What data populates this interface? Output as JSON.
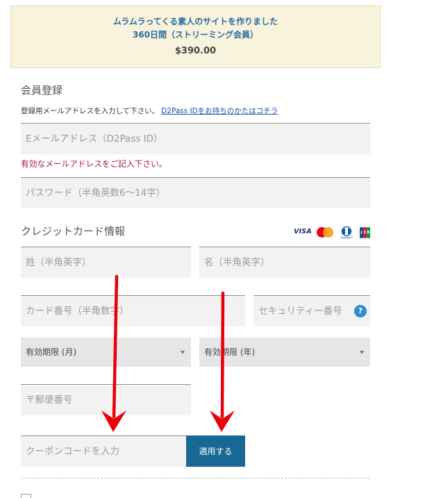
{
  "product": {
    "name": "ムラムラってくる素人のサイトを作りました",
    "plan": "360日間（ストリーミング会員）",
    "price": "$390.00"
  },
  "member": {
    "heading": "会員登録",
    "instruction": "登録用メールアドレスを入力して下さい。",
    "d2pass_link": "D2Pass IDをお持ちのかたはコチラ",
    "email": {
      "value": "",
      "placeholder": "Eメールアドレス（D2Pass ID）"
    },
    "email_error": "有効なメールアドレスをご記入下さい。",
    "password": {
      "value": "",
      "placeholder": "パスワード（半角英数6～14字）"
    }
  },
  "card": {
    "heading": "クレジットカード情報",
    "brands": [
      {
        "name": "VISA",
        "icon": "visa-logo"
      },
      {
        "name": "MasterCard",
        "icon": "mastercard-logo"
      },
      {
        "name": "Diners Club International",
        "icon": "diners-club-logo"
      },
      {
        "name": "JCB",
        "icon": "jcb-logo",
        "letters": [
          "J",
          "C",
          "B"
        ]
      }
    ],
    "last_name": {
      "value": "",
      "placeholder": "姓（半角英字）"
    },
    "first_name": {
      "value": "",
      "placeholder": "名（半角英字）"
    },
    "number": {
      "value": "",
      "placeholder": "カード番号（半角数字）"
    },
    "security_code": {
      "value": "",
      "placeholder": "セキュリティー番号",
      "help": "?"
    },
    "expiry_month": "有効期限 (月)",
    "expiry_year": "有効期限 (年)",
    "postal_code": {
      "value": "",
      "placeholder": "〒郵便番号"
    }
  },
  "coupon": {
    "value": "",
    "placeholder": "クーポンコードを入力",
    "apply_label": "適用する"
  },
  "offer_checkbox": {
    "checked": false
  },
  "icons": {
    "select_arrow": "triangle-down-icon",
    "help": "question-circle-icon",
    "annotation": "red-arrow-annotation"
  },
  "colors": {
    "product_bg": "#f8f3dc",
    "product_border": "#e6ddbb",
    "product_title": "#2c6aa0",
    "link": "#1a4fa3",
    "error": "#a8174a",
    "field_bg": "#f2f2f2",
    "select_bg": "#e6e6e6",
    "button_bg": "#176895",
    "help_icon": "#2a8fd0",
    "annotation_arrow": "#e8000b"
  }
}
